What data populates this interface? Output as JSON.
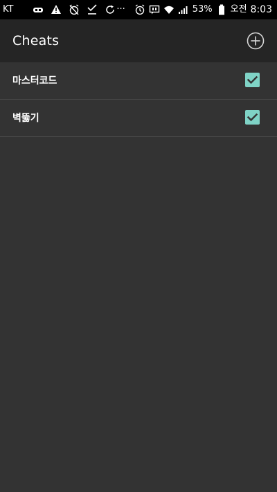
{
  "status_bar": {
    "carrier": "KT",
    "battery_percent": "53%",
    "am_pm": "오전",
    "time": "8:03",
    "overflow": "···",
    "left_icons": [
      "eye-glasses-icon",
      "warning-icon",
      "alarm-off-icon",
      "download-done-icon",
      "sync-icon"
    ],
    "right_icons": [
      "alarm-icon",
      "chat-icon",
      "wifi-icon",
      "signal-icon",
      "battery-icon"
    ]
  },
  "app_bar": {
    "title": "Cheats",
    "add_icon": "plus-circle-icon"
  },
  "cheats": [
    {
      "label": "마스터코드",
      "checked": true
    },
    {
      "label": "벽뚫기",
      "checked": true
    }
  ],
  "colors": {
    "status_bar_bg": "#000000",
    "app_bar_bg": "#252525",
    "body_bg": "#333333",
    "divider": "#4a4a4a",
    "checkbox_accent": "#7fd3c6"
  }
}
